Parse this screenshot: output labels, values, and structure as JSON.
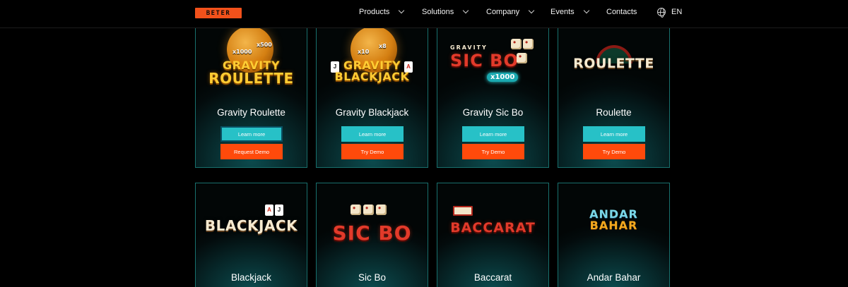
{
  "header": {
    "logo_text": "BETER",
    "nav": [
      {
        "label": "Products",
        "has_dropdown": true
      },
      {
        "label": "Solutions",
        "has_dropdown": true
      },
      {
        "label": "Company",
        "has_dropdown": true
      },
      {
        "label": "Events",
        "has_dropdown": true
      },
      {
        "label": "Contacts",
        "has_dropdown": false
      }
    ],
    "language": "EN",
    "language_icon": "globe-icon"
  },
  "games": [
    {
      "title": "Gravity Roulette",
      "art": {
        "line1": "GRAVITY",
        "line2": "ROULETTE",
        "mult_a": "x1000",
        "mult_b": "x500"
      },
      "learn_label": "Learn more",
      "demo_label": "Request Demo"
    },
    {
      "title": "Gravity Blackjack",
      "art": {
        "line1": "GRAVITY",
        "line2": "BLACKJACK",
        "mult_a": "x10",
        "mult_b": "x8"
      },
      "learn_label": "Learn more",
      "demo_label": "Try Demo"
    },
    {
      "title": "Gravity Sic Bo",
      "art": {
        "line1": "GRAVITY",
        "line2": "SIC BO",
        "mult_a": "x1000"
      },
      "learn_label": "Learn more",
      "demo_label": "Try Demo"
    },
    {
      "title": "Roulette",
      "art": {
        "line1": "ROULETTE"
      },
      "learn_label": "Learn more",
      "demo_label": "Try Demo"
    },
    {
      "title": "Blackjack",
      "art": {
        "line1": "BLACKJACK"
      }
    },
    {
      "title": "Sic Bo",
      "art": {
        "line1": "SIC BO"
      }
    },
    {
      "title": "Baccarat",
      "art": {
        "line1": "BACCARAT"
      }
    },
    {
      "title": "Andar Bahar",
      "art": {
        "line1": "ANDAR",
        "line2": "BAHAR"
      }
    }
  ],
  "colors": {
    "accent_orange": "#ff4a0b",
    "accent_teal": "#27c1c7",
    "card_border": "#18706d",
    "background": "#000000"
  }
}
